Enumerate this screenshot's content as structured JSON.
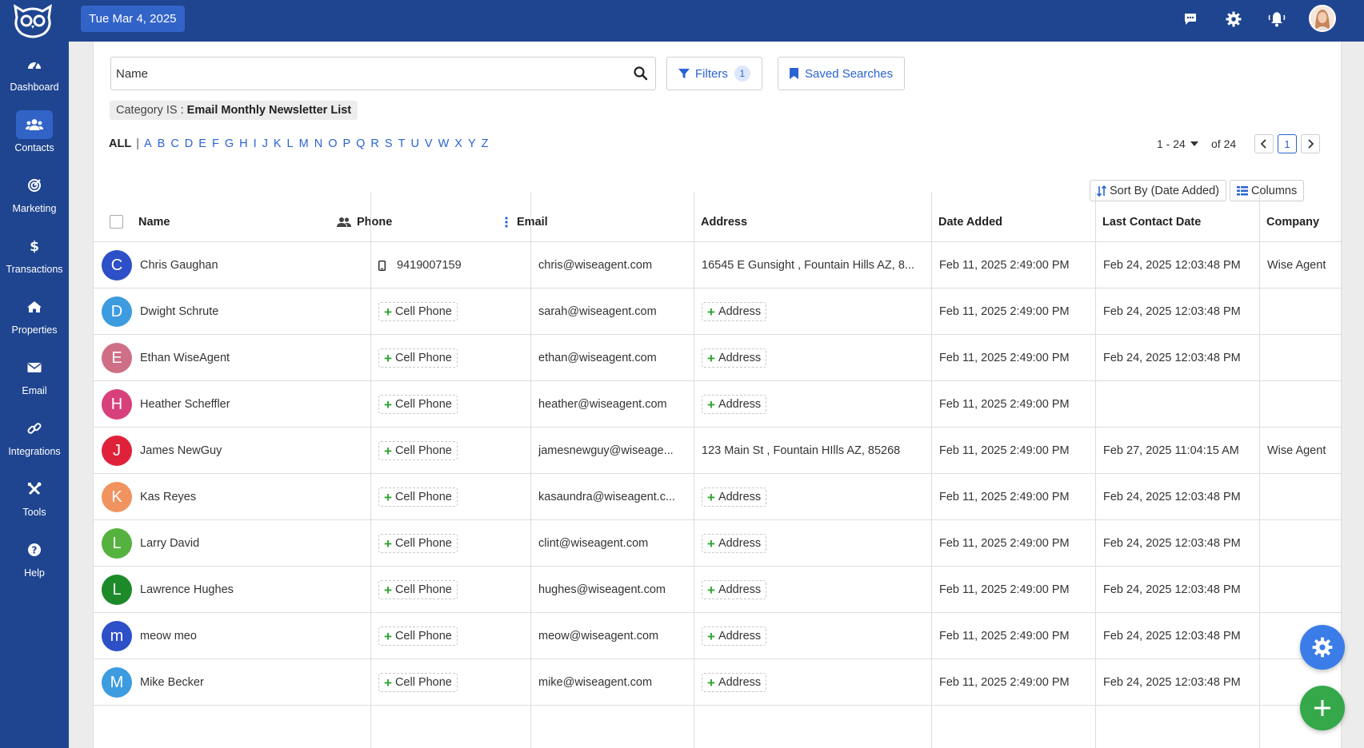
{
  "topbar": {
    "date": "Tue Mar 4, 2025"
  },
  "sidebar": {
    "items": [
      {
        "label": "Dashboard",
        "icon": "dashboard-gauge-icon"
      },
      {
        "label": "Contacts",
        "icon": "users-icon",
        "active": true
      },
      {
        "label": "Marketing",
        "icon": "target-icon"
      },
      {
        "label": "Transactions",
        "icon": "dollar-icon"
      },
      {
        "label": "Properties",
        "icon": "home-icon"
      },
      {
        "label": "Email",
        "icon": "envelope-icon"
      },
      {
        "label": "Integrations",
        "icon": "link-icon"
      },
      {
        "label": "Tools",
        "icon": "tools-icon"
      },
      {
        "label": "Help",
        "icon": "help-icon"
      }
    ]
  },
  "search": {
    "placeholder": "Name"
  },
  "toolbar": {
    "filters_label": "Filters",
    "filters_count": "1",
    "saved_searches_label": "Saved Searches",
    "sort_label": "Sort By (Date Added)",
    "columns_label": "Columns"
  },
  "filter_tag": {
    "prefix": "Category IS :",
    "value": "Email Monthly Newsletter List"
  },
  "alphabet": {
    "all": "ALL",
    "separator": "|",
    "letters": [
      "A",
      "B",
      "C",
      "D",
      "E",
      "F",
      "G",
      "H",
      "I",
      "J",
      "K",
      "L",
      "M",
      "N",
      "O",
      "P",
      "Q",
      "R",
      "S",
      "T",
      "U",
      "V",
      "W",
      "X",
      "Y",
      "Z"
    ]
  },
  "pager": {
    "range": "1 - 24",
    "of": "of 24",
    "current": "1"
  },
  "table": {
    "headers": {
      "name": "Name",
      "phone": "Phone",
      "email": "Email",
      "address": "Address",
      "date_added": "Date Added",
      "last_contact": "Last Contact Date",
      "company": "Company"
    },
    "add_phone_label": "Cell Phone",
    "add_address_label": "Address",
    "rows": [
      {
        "initial": "C",
        "color": "#2d4fc7",
        "name": "Chris Gaughan",
        "phone": "9419007159",
        "email": "chris@wiseagent.com",
        "address": "16545 E Gunsight , Fountain Hills AZ, 8...",
        "date_added": "Feb 11, 2025 2:49:00 PM",
        "last_contact": "Feb 24, 2025 12:03:48 PM",
        "company": "Wise Agent"
      },
      {
        "initial": "D",
        "color": "#3d9be0",
        "name": "Dwight Schrute",
        "phone": "",
        "email": "sarah@wiseagent.com",
        "address": "",
        "date_added": "Feb 11, 2025 2:49:00 PM",
        "last_contact": "Feb 24, 2025 12:03:48 PM",
        "company": ""
      },
      {
        "initial": "E",
        "color": "#cf6f86",
        "name": "Ethan WiseAgent",
        "phone": "",
        "email": "ethan@wiseagent.com",
        "address": "",
        "date_added": "Feb 11, 2025 2:49:00 PM",
        "last_contact": "Feb 24, 2025 12:03:48 PM",
        "company": ""
      },
      {
        "initial": "H",
        "color": "#d8407c",
        "name": "Heather Scheffler",
        "phone": "",
        "email": "heather@wiseagent.com",
        "address": "",
        "date_added": "Feb 11, 2025 2:49:00 PM",
        "last_contact": "",
        "company": ""
      },
      {
        "initial": "J",
        "color": "#e0213a",
        "name": "James NewGuy",
        "phone": "",
        "email": "jamesnewguy@wiseage...",
        "address": "123 Main St , Fountain HIlls AZ, 85268",
        "date_added": "Feb 11, 2025 2:49:00 PM",
        "last_contact": "Feb 27, 2025 11:04:15 AM",
        "company": "Wise Agent"
      },
      {
        "initial": "K",
        "color": "#f0935f",
        "name": "Kas Reyes",
        "phone": "",
        "email": "kasaundra@wiseagent.c...",
        "address": "",
        "date_added": "Feb 11, 2025 2:49:00 PM",
        "last_contact": "Feb 24, 2025 12:03:48 PM",
        "company": ""
      },
      {
        "initial": "L",
        "color": "#55b23e",
        "name": "Larry David",
        "phone": "",
        "email": "clint@wiseagent.com",
        "address": "",
        "date_added": "Feb 11, 2025 2:49:00 PM",
        "last_contact": "Feb 24, 2025 12:03:48 PM",
        "company": ""
      },
      {
        "initial": "L",
        "color": "#1d8a2a",
        "name": "Lawrence Hughes",
        "phone": "",
        "email": "hughes@wiseagent.com",
        "address": "",
        "date_added": "Feb 11, 2025 2:49:00 PM",
        "last_contact": "Feb 24, 2025 12:03:48 PM",
        "company": ""
      },
      {
        "initial": "m",
        "color": "#2d4fc7",
        "name": "meow meo",
        "phone": "",
        "email": "meow@wiseagent.com",
        "address": "",
        "date_added": "Feb 11, 2025 2:49:00 PM",
        "last_contact": "Feb 24, 2025 12:03:48 PM",
        "company": ""
      },
      {
        "initial": "M",
        "color": "#3d9be0",
        "name": "Mike Becker",
        "phone": "",
        "email": "mike@wiseagent.com",
        "address": "",
        "date_added": "Feb 11, 2025 2:49:00 PM",
        "last_contact": "Feb 24, 2025 12:03:48 PM",
        "company": ""
      }
    ]
  },
  "colors": {
    "brand": "#1f4590",
    "accent": "#2b63d3",
    "fab_settings": "#3b7de8",
    "fab_add": "#35a84a"
  }
}
